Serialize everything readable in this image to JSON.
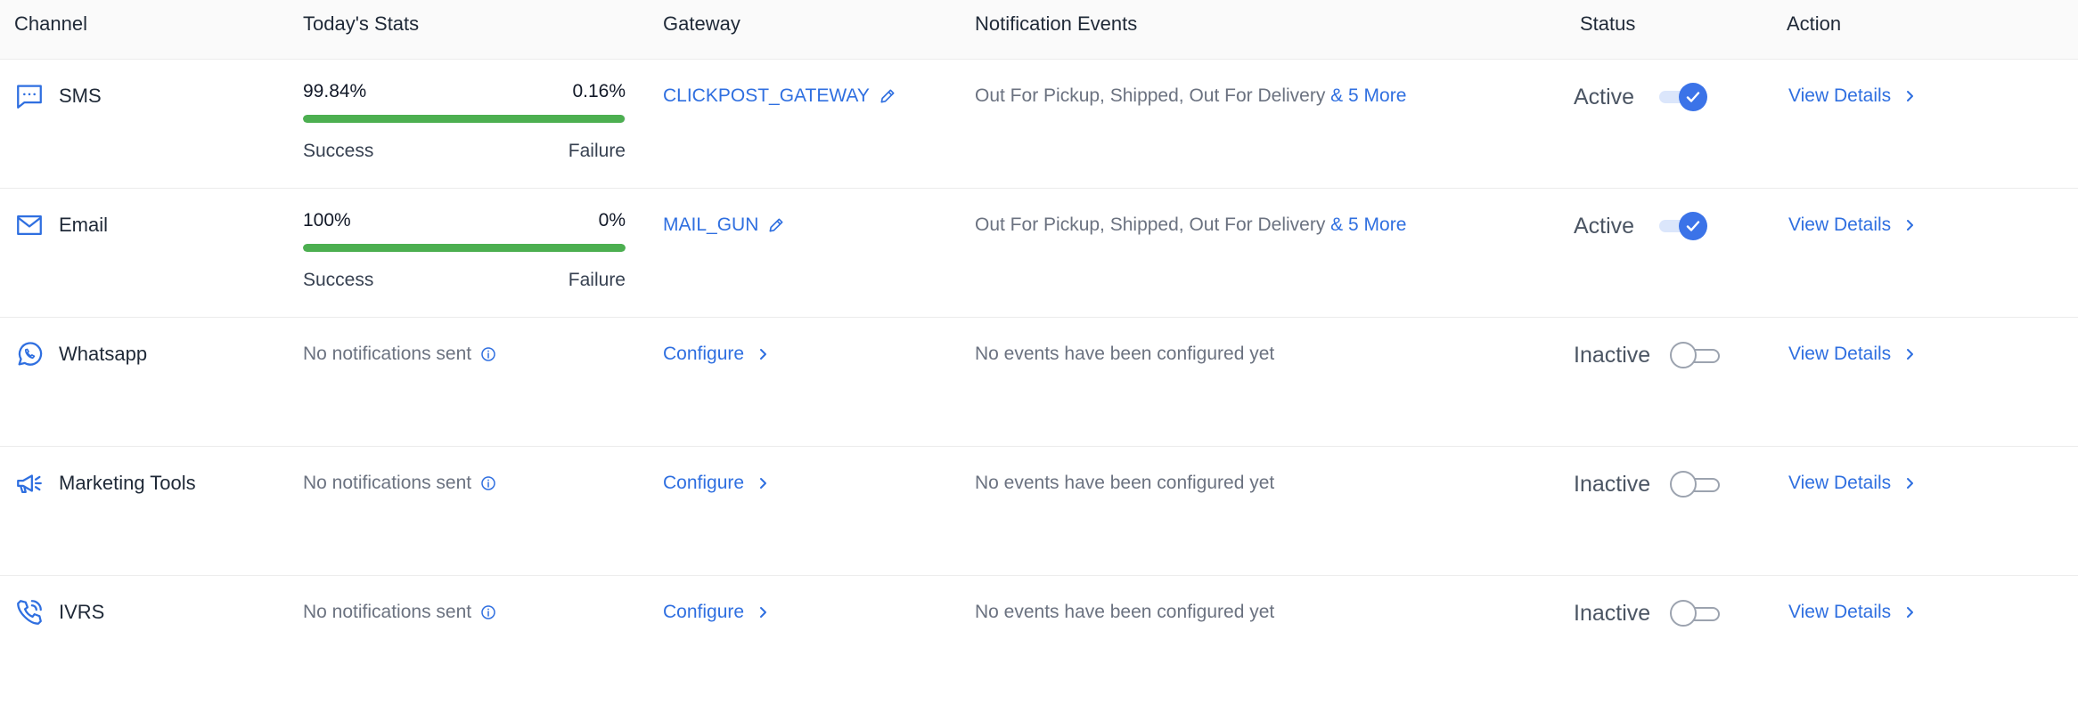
{
  "headers": {
    "channel": "Channel",
    "stats": "Today's Stats",
    "gateway": "Gateway",
    "events": "Notification Events",
    "status": "Status",
    "action": "Action"
  },
  "colors": {
    "link": "#2f6fe0",
    "success_bar": "#4caf50",
    "toggle_on": "#3b73e8"
  },
  "rows": [
    {
      "channel": "SMS",
      "icon": "chat-bubble-icon",
      "stats": {
        "success": "99.84%",
        "failure": "0.16%",
        "success_label": "Success",
        "failure_label": "Failure",
        "success_fraction": 0.9984
      },
      "gateway": "CLICKPOST_GATEWAY",
      "events": "Out For Pickup, Shipped, Out For Delivery",
      "events_more": "& 5 More",
      "status": "Active",
      "action": "View Details"
    },
    {
      "channel": "Email",
      "icon": "envelope-icon",
      "stats": {
        "success": "100%",
        "failure": "0%",
        "success_label": "Success",
        "failure_label": "Failure",
        "success_fraction": 1.0
      },
      "gateway": "MAIL_GUN",
      "events": "Out For Pickup, Shipped, Out For Delivery",
      "events_more": "& 5 More",
      "status": "Active",
      "action": "View Details"
    },
    {
      "channel": "Whatsapp",
      "icon": "whatsapp-icon",
      "no_stats": "No notifications sent",
      "gateway_link": "Configure",
      "events": "No events have been configured yet",
      "status": "Inactive",
      "action": "View Details"
    },
    {
      "channel": "Marketing Tools",
      "icon": "megaphone-icon",
      "no_stats": "No notifications sent",
      "gateway_link": "Configure",
      "events": "No events have been configured yet",
      "status": "Inactive",
      "action": "View Details"
    },
    {
      "channel": "IVRS",
      "icon": "phone-call-icon",
      "no_stats": "No notifications sent",
      "gateway_link": "Configure",
      "events": "No events have been configured yet",
      "status": "Inactive",
      "action": "View Details"
    }
  ]
}
